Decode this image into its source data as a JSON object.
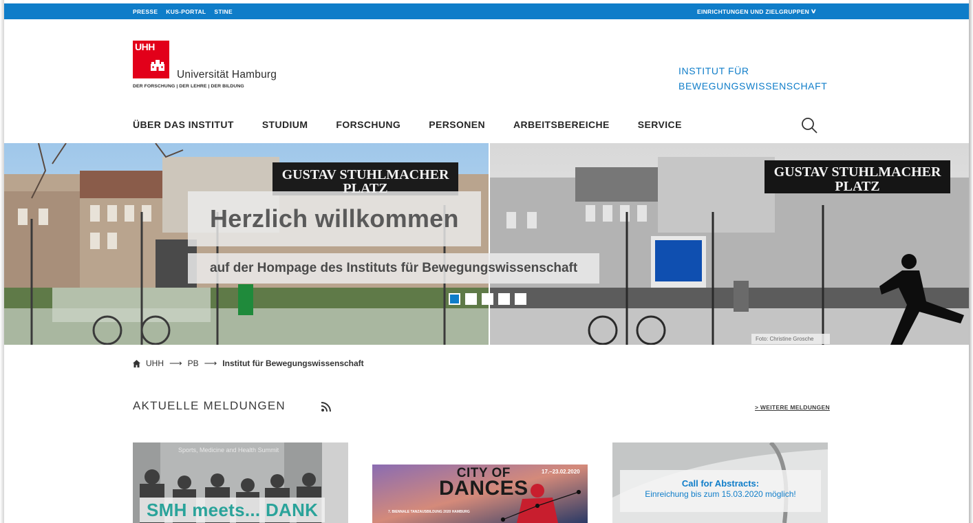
{
  "topbar": {
    "links": [
      "PRESSE",
      "KUS-PORTAL",
      "STINE"
    ],
    "dropdown": "EINRICHTUNGEN UND ZIELGRUPPEN"
  },
  "logo": {
    "mark": "UHH",
    "name": "Universität Hamburg",
    "tagline": "DER FORSCHUNG | DER LEHRE | DER BILDUNG",
    "color": "#e2001a"
  },
  "institute": {
    "line1": "INSTITUT FÜR",
    "line2": "BEWEGUNGSWISSENSCHAFT"
  },
  "nav": {
    "items": [
      "ÜBER DAS INSTITUT",
      "STUDIUM",
      "FORSCHUNG",
      "PERSONEN",
      "ARBEITSBEREICHE",
      "SERVICE"
    ]
  },
  "hero": {
    "title": "Herzlich willkommen",
    "subtitle": "auf der Hompage des Instituts für Bewegungswissenschaft",
    "sign_line1": "GUSTAV STUHLMACHER",
    "sign_line2": "PLATZ",
    "photo_credit": "Foto: Christine Grosche",
    "slide_count": 5,
    "active_slide": 1
  },
  "breadcrumb": {
    "items": [
      "UHH",
      "PB"
    ],
    "current": "Institut für Bewegungswissenschaft"
  },
  "news": {
    "heading": "AKTUELLE MELDUNGEN",
    "more_link": "> WEITERE MELDUNGEN",
    "cards": [
      {
        "label": "SMH meets... DANK",
        "summit": "Sports, Medicine and Health Summit"
      },
      {
        "city_line1": "CITY OF",
        "city_line2": "DANCES",
        "date": "17.–23.02.2020",
        "biennale": "7. BIENNALE TANZAUSBILDUNG 2020 HAMBURG"
      },
      {
        "title": "Call for Abstracts:",
        "subtitle": "Einreichung bis zum 15.03.2020 möglich!"
      }
    ]
  },
  "colors": {
    "accent": "#0f7dc9",
    "brand_red": "#e2001a",
    "teal": "#2aa39a"
  }
}
